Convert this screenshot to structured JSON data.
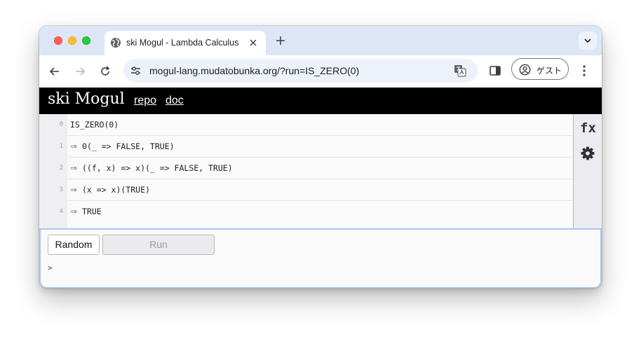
{
  "browser": {
    "tab_title": "ski Mogul - Lambda Calculus",
    "url": "mogul-lang.mudatobunka.org/?run=IS_ZERO(0)",
    "profile_label": "ゲスト"
  },
  "app": {
    "brand": "ski Mogul",
    "links": [
      "repo",
      "doc"
    ],
    "side_fx_label": "fx"
  },
  "editor": {
    "lines": [
      {
        "num": "0",
        "arrow": "",
        "text": "IS_ZERO(0)"
      },
      {
        "num": "1",
        "arrow": "⇒",
        "text": "0(_ => FALSE, TRUE)"
      },
      {
        "num": "2",
        "arrow": "⇒",
        "text": "((f, x) => x)(_ => FALSE, TRUE)"
      },
      {
        "num": "3",
        "arrow": "⇒",
        "text": "(x => x)(TRUE)"
      },
      {
        "num": "4",
        "arrow": "⇒",
        "text": "TRUE"
      }
    ]
  },
  "console": {
    "random_label": "Random",
    "run_label": "Run",
    "prompt": ">"
  },
  "colors": {
    "header_bg": "#000000",
    "console_border": "#a9c6ee",
    "tabstrip_bg": "#dde6f6"
  }
}
